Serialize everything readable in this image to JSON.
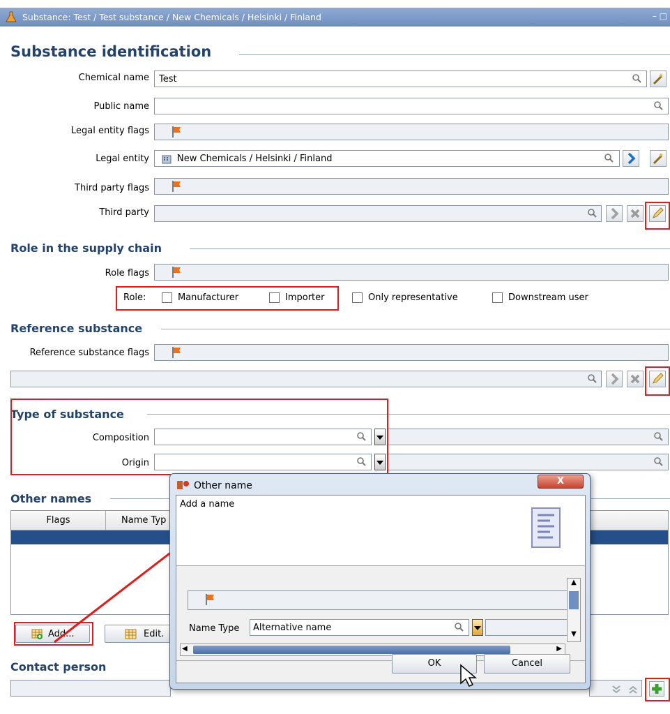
{
  "title_bar": {
    "text": "Substance: Test  / Test substance / New Chemicals / Helsinki / Finland",
    "controls": "– □"
  },
  "identification": {
    "heading": "Substance identification",
    "chemical_name_label": "Chemical name",
    "chemical_name_value": "Test",
    "public_name_label": "Public name",
    "public_name_value": "",
    "legal_entity_flags_label": "Legal entity flags",
    "legal_entity_label": "Legal entity",
    "legal_entity_value": "New Chemicals / Helsinki / Finland",
    "third_party_flags_label": "Third party flags",
    "third_party_label": "Third party",
    "third_party_value": ""
  },
  "supply_chain": {
    "heading": "Role in the supply chain",
    "role_flags_label": "Role flags",
    "role_label": "Role:",
    "roles": [
      "Manufacturer",
      "Importer",
      "Only representative",
      "Downstream user"
    ]
  },
  "reference": {
    "heading": "Reference substance",
    "flags_label": "Reference substance flags",
    "value": ""
  },
  "type": {
    "heading": "Type of substance",
    "composition_label": "Composition",
    "origin_label": "Origin"
  },
  "other_names": {
    "heading": "Other names",
    "columns": [
      "Flags",
      "Name Typ"
    ],
    "add_label": "Add...",
    "edit_label": "Edit."
  },
  "contact": {
    "heading": "Contact person"
  },
  "dialog": {
    "title": "Other name",
    "close_label": "X",
    "description": "Add a name",
    "name_type_label": "Name Type",
    "name_type_value": "Alternative name",
    "ok_label": "OK",
    "cancel_label": "Cancel"
  },
  "colors": {
    "heading": "#23436b",
    "highlight": "#e21b1b",
    "selected_row": "#244f8a",
    "titlebar": "#7f9dcb"
  }
}
